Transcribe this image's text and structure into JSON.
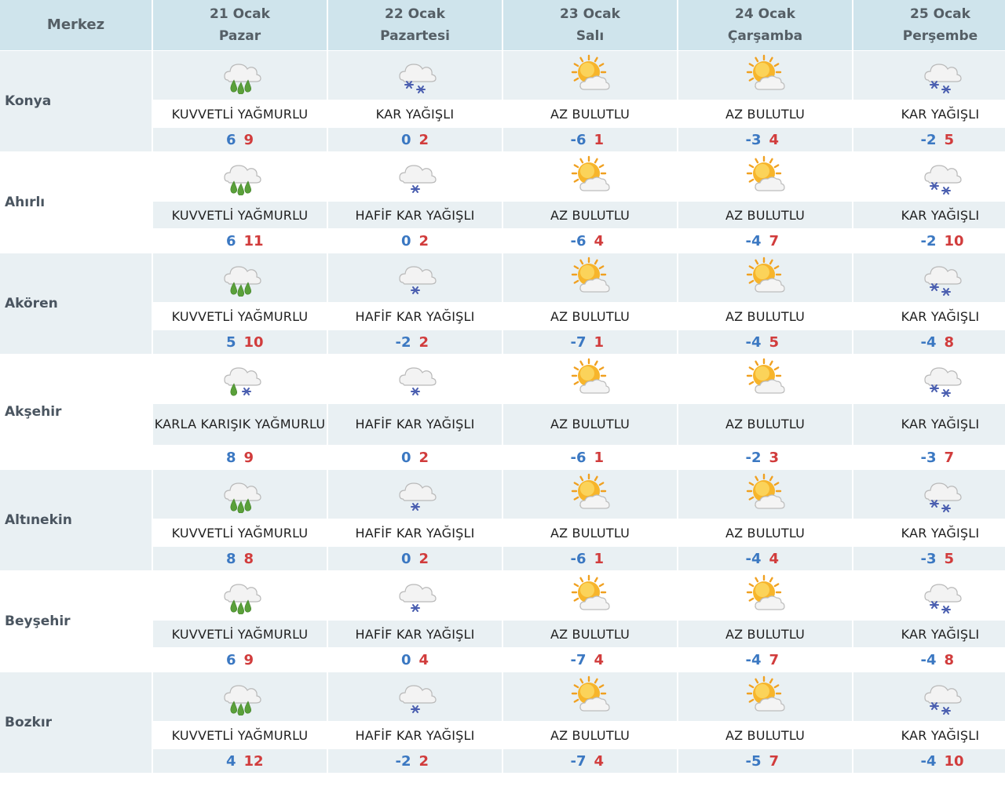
{
  "header": {
    "center_label": "Merkez",
    "days": [
      {
        "date": "21 Ocak",
        "weekday": "Pazar"
      },
      {
        "date": "22 Ocak",
        "weekday": "Pazartesi"
      },
      {
        "date": "23 Ocak",
        "weekday": "Salı"
      },
      {
        "date": "24 Ocak",
        "weekday": "Çarşamba"
      },
      {
        "date": "25 Ocak",
        "weekday": "Perşembe"
      }
    ]
  },
  "colors": {
    "header_bg": "#cfe4ec",
    "stripe_bg": "#e9f0f3",
    "min_temp": "#3b78c2",
    "max_temp": "#d13c3c"
  },
  "rows": [
    {
      "name": "Konya",
      "days": [
        {
          "icon": "heavy-rain-icon",
          "condition": "KUVVETLİ YAĞMURLU",
          "min": "6",
          "max": "9"
        },
        {
          "icon": "snow-icon",
          "condition": "KAR YAĞIŞLI",
          "min": "0",
          "max": "2"
        },
        {
          "icon": "partly-cloudy-icon",
          "condition": "AZ BULUTLU",
          "min": "-6",
          "max": "1"
        },
        {
          "icon": "partly-cloudy-icon",
          "condition": "AZ BULUTLU",
          "min": "-3",
          "max": "4"
        },
        {
          "icon": "snow-icon",
          "condition": "KAR YAĞIŞLI",
          "min": "-2",
          "max": "5"
        }
      ]
    },
    {
      "name": "Ahırlı",
      "days": [
        {
          "icon": "heavy-rain-icon",
          "condition": "KUVVETLİ YAĞMURLU",
          "min": "6",
          "max": "11"
        },
        {
          "icon": "light-snow-icon",
          "condition": "HAFİF KAR YAĞIŞLI",
          "min": "0",
          "max": "2"
        },
        {
          "icon": "partly-cloudy-icon",
          "condition": "AZ BULUTLU",
          "min": "-6",
          "max": "4"
        },
        {
          "icon": "partly-cloudy-icon",
          "condition": "AZ BULUTLU",
          "min": "-4",
          "max": "7"
        },
        {
          "icon": "snow-icon",
          "condition": "KAR YAĞIŞLI",
          "min": "-2",
          "max": "10"
        }
      ]
    },
    {
      "name": "Akören",
      "days": [
        {
          "icon": "heavy-rain-icon",
          "condition": "KUVVETLİ YAĞMURLU",
          "min": "5",
          "max": "10"
        },
        {
          "icon": "light-snow-icon",
          "condition": "HAFİF KAR YAĞIŞLI",
          "min": "-2",
          "max": "2"
        },
        {
          "icon": "partly-cloudy-icon",
          "condition": "AZ BULUTLU",
          "min": "-7",
          "max": "1"
        },
        {
          "icon": "partly-cloudy-icon",
          "condition": "AZ BULUTLU",
          "min": "-4",
          "max": "5"
        },
        {
          "icon": "snow-icon",
          "condition": "KAR YAĞIŞLI",
          "min": "-4",
          "max": "8"
        }
      ]
    },
    {
      "name": "Akşehir",
      "days": [
        {
          "icon": "sleet-icon",
          "condition": "KARLA KARIŞIK YAĞMURLU",
          "min": "8",
          "max": "9"
        },
        {
          "icon": "light-snow-icon",
          "condition": "HAFİF KAR YAĞIŞLI",
          "min": "0",
          "max": "2"
        },
        {
          "icon": "partly-cloudy-icon",
          "condition": "AZ BULUTLU",
          "min": "-6",
          "max": "1"
        },
        {
          "icon": "partly-cloudy-icon",
          "condition": "AZ BULUTLU",
          "min": "-2",
          "max": "3"
        },
        {
          "icon": "snow-icon",
          "condition": "KAR YAĞIŞLI",
          "min": "-3",
          "max": "7"
        }
      ]
    },
    {
      "name": "Altınekin",
      "days": [
        {
          "icon": "heavy-rain-icon",
          "condition": "KUVVETLİ YAĞMURLU",
          "min": "8",
          "max": "8"
        },
        {
          "icon": "light-snow-icon",
          "condition": "HAFİF KAR YAĞIŞLI",
          "min": "0",
          "max": "2"
        },
        {
          "icon": "partly-cloudy-icon",
          "condition": "AZ BULUTLU",
          "min": "-6",
          "max": "1"
        },
        {
          "icon": "partly-cloudy-icon",
          "condition": "AZ BULUTLU",
          "min": "-4",
          "max": "4"
        },
        {
          "icon": "snow-icon",
          "condition": "KAR YAĞIŞLI",
          "min": "-3",
          "max": "5"
        }
      ]
    },
    {
      "name": "Beyşehir",
      "days": [
        {
          "icon": "heavy-rain-icon",
          "condition": "KUVVETLİ YAĞMURLU",
          "min": "6",
          "max": "9"
        },
        {
          "icon": "light-snow-icon",
          "condition": "HAFİF KAR YAĞIŞLI",
          "min": "0",
          "max": "4"
        },
        {
          "icon": "partly-cloudy-icon",
          "condition": "AZ BULUTLU",
          "min": "-7",
          "max": "4"
        },
        {
          "icon": "partly-cloudy-icon",
          "condition": "AZ BULUTLU",
          "min": "-4",
          "max": "7"
        },
        {
          "icon": "snow-icon",
          "condition": "KAR YAĞIŞLI",
          "min": "-4",
          "max": "8"
        }
      ]
    },
    {
      "name": "Bozkır",
      "days": [
        {
          "icon": "heavy-rain-icon",
          "condition": "KUVVETLİ YAĞMURLU",
          "min": "4",
          "max": "12"
        },
        {
          "icon": "light-snow-icon",
          "condition": "HAFİF KAR YAĞIŞLI",
          "min": "-2",
          "max": "2"
        },
        {
          "icon": "partly-cloudy-icon",
          "condition": "AZ BULUTLU",
          "min": "-7",
          "max": "4"
        },
        {
          "icon": "partly-cloudy-icon",
          "condition": "AZ BULUTLU",
          "min": "-5",
          "max": "7"
        },
        {
          "icon": "snow-icon",
          "condition": "KAR YAĞIŞLI",
          "min": "-4",
          "max": "10"
        }
      ]
    }
  ]
}
